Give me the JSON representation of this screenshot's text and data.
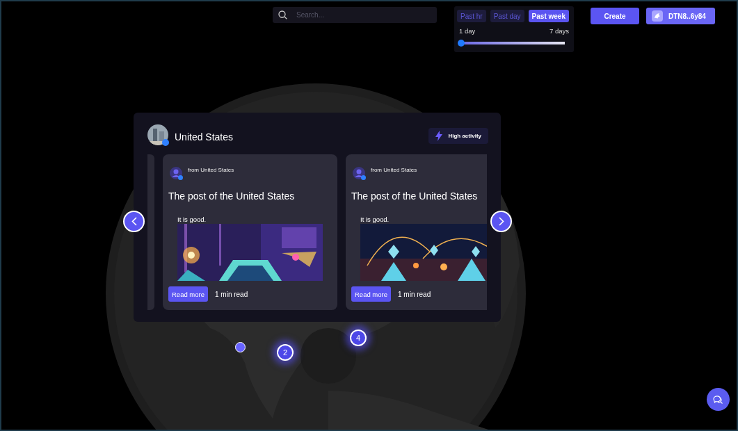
{
  "search": {
    "placeholder": "Search..."
  },
  "time_filter": {
    "tabs": [
      {
        "label": "Past hr",
        "selected": false
      },
      {
        "label": "Past day",
        "selected": false
      },
      {
        "label": "Past week",
        "selected": true
      }
    ],
    "range_min": "1 day",
    "range_max": "7 days",
    "level": 0
  },
  "actions": {
    "create": "Create",
    "wallet": "DTN8..6y84"
  },
  "map": {
    "markers": [
      {
        "kind": "dot"
      },
      {
        "kind": "cluster",
        "count": "2"
      },
      {
        "kind": "cluster",
        "count": "4"
      }
    ]
  },
  "region_card": {
    "title": "United States",
    "badge": "High activity",
    "posts": [
      {
        "source": "from United States",
        "title": "The post of the United States",
        "excerpt": "It is good.",
        "button": "Read more",
        "read_time": "1 min read"
      },
      {
        "source": "from United States",
        "title": "The post of the United States",
        "excerpt": "It is good.",
        "button": "Read more",
        "read_time": "1 min read"
      }
    ]
  }
}
